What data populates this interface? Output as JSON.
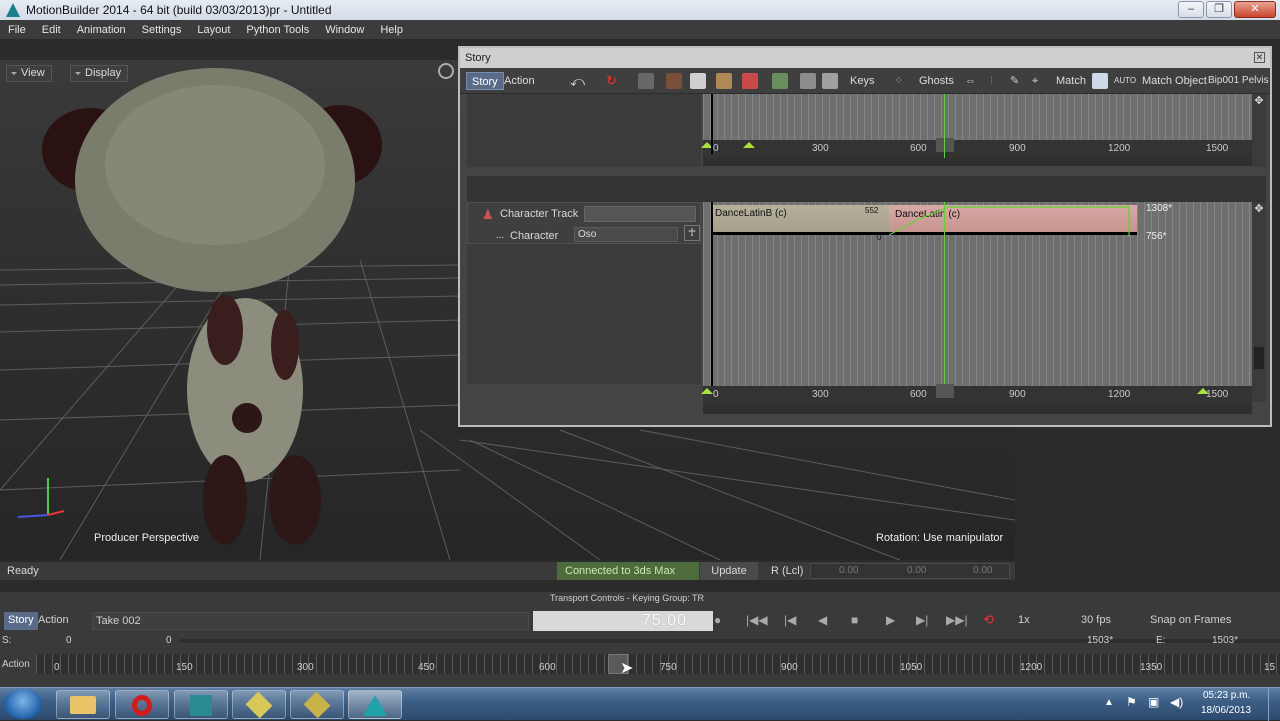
{
  "window": {
    "title": "MotionBuilder 2014   - 64 bit (build 03/03/2013)pr  - Untitled"
  },
  "menu": [
    "File",
    "Edit",
    "Animation",
    "Settings",
    "Layout",
    "Python Tools",
    "Window",
    "Help"
  ],
  "viewer": {
    "view_label": "View",
    "display_label": "Display",
    "camera_label": "Producer Perspective",
    "rotation_label": "Rotation: Use manipulator"
  },
  "story": {
    "title": "Story",
    "tabs": [
      "Story",
      "Action"
    ],
    "toolbar": {
      "keys": "Keys",
      "ghosts": "Ghosts",
      "match": "Match",
      "match_object": "Match Object",
      "object_value": "Bip001 Pelvis"
    },
    "ruler_ticks": [
      "0",
      "300",
      "600",
      "900",
      "1200",
      "1500"
    ],
    "track": {
      "name": "Character Track",
      "character_label": "Character",
      "character_value": "Oso",
      "ellipsis": "..."
    },
    "clips": [
      {
        "name": "DanceLatinB (c)",
        "end_label": "552"
      },
      {
        "name": "DanceLatin (c)",
        "start_label": "0",
        "end_top": "1308*",
        "end_bottom": "756*"
      }
    ]
  },
  "status": {
    "ready": "Ready",
    "connected": "Connected to 3ds Max",
    "update": "Update",
    "rlabel": "R (Lcl)",
    "values": [
      "0.00",
      "0.00",
      "0.00"
    ]
  },
  "transport": {
    "header": "Transport Controls  -  Keying Group: TR",
    "tabs": [
      "Story",
      "Action"
    ],
    "take": "Take 002",
    "frame": "75.00",
    "speed": "1x",
    "fps": "30 fps",
    "snap": "Snap on Frames",
    "start_label": "S:",
    "start_value": "0",
    "start_value2": "0",
    "end_label": "E:",
    "end_value": "1503*",
    "end_value2": "1503*",
    "action_label": "Action",
    "timeline_ticks": [
      "0",
      "150",
      "300",
      "450",
      "600",
      "750",
      "900",
      "1050",
      "1200",
      "1350",
      "15"
    ]
  },
  "taskbar": {
    "time": "05:23 p.m.",
    "date": "18/06/2013"
  },
  "colors": {
    "accent_green": "#5cd62e",
    "clip_band": "#c9a6a0",
    "tab_blue": "#5a6b8a"
  }
}
